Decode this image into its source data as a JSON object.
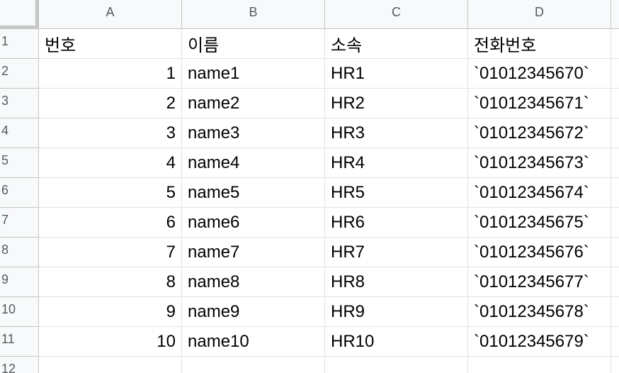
{
  "columns": [
    "A",
    "B",
    "C",
    "D"
  ],
  "row_numbers": [
    "1",
    "2",
    "3",
    "4",
    "5",
    "6",
    "7",
    "8",
    "9",
    "10",
    "11",
    "12"
  ],
  "header_row": [
    "번호",
    "이름",
    "소속",
    "전화번호"
  ],
  "rows": [
    [
      "1",
      "name1",
      "HR1",
      "`01012345670`"
    ],
    [
      "2",
      "name2",
      "HR2",
      "`01012345671`"
    ],
    [
      "3",
      "name3",
      "HR3",
      "`01012345672`"
    ],
    [
      "4",
      "name4",
      "HR4",
      "`01012345673`"
    ],
    [
      "5",
      "name5",
      "HR5",
      "`01012345674`"
    ],
    [
      "6",
      "name6",
      "HR6",
      "`01012345675`"
    ],
    [
      "7",
      "name7",
      "HR7",
      "`01012345676`"
    ],
    [
      "8",
      "name8",
      "HR8",
      "`01012345677`"
    ],
    [
      "9",
      "name9",
      "HR9",
      "`01012345678`"
    ],
    [
      "10",
      "name10",
      "HR10",
      "`01012345679`"
    ]
  ],
  "colors": {
    "header_bg": "#f8f9fa",
    "header_text": "#575a5c",
    "grid_line": "#e2e3e3",
    "header_line": "#c4c7c5"
  }
}
